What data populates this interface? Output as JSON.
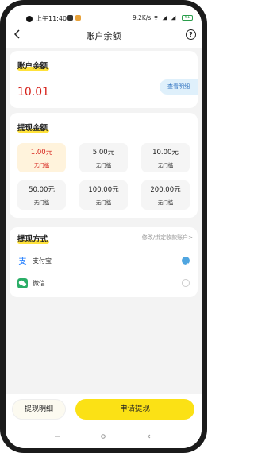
{
  "status_bar": {
    "time": "上午11:40",
    "network_speed": "9.2K/s",
    "battery": "61"
  },
  "header": {
    "title": "账户余额",
    "help_icon": "?"
  },
  "balance_card": {
    "title": "账户余额",
    "amount": "10.01",
    "detail_button": "查看明细"
  },
  "withdraw_amount": {
    "title": "提现金额",
    "options": [
      {
        "value": "1.00元",
        "sub": "无门槛",
        "selected": true
      },
      {
        "value": "5.00元",
        "sub": "无门槛",
        "selected": false
      },
      {
        "value": "10.00元",
        "sub": "无门槛",
        "selected": false
      },
      {
        "value": "50.00元",
        "sub": "无门槛",
        "selected": false
      },
      {
        "value": "100.00元",
        "sub": "无门槛",
        "selected": false
      },
      {
        "value": "200.00元",
        "sub": "无门槛",
        "selected": false
      }
    ]
  },
  "withdraw_method": {
    "title": "提现方式",
    "modify_link": "修改/绑定收款账户>",
    "methods": [
      {
        "label": "支付宝",
        "icon": "alipay-icon",
        "selected": true
      },
      {
        "label": "微信",
        "icon": "wechat-icon",
        "selected": false
      }
    ]
  },
  "bottom_bar": {
    "detail_label": "提现明细",
    "apply_label": "申请提现"
  },
  "colors": {
    "accent_yellow": "#fbe115",
    "balance_red": "#d6221b",
    "link_blue": "#2b6fbf"
  }
}
